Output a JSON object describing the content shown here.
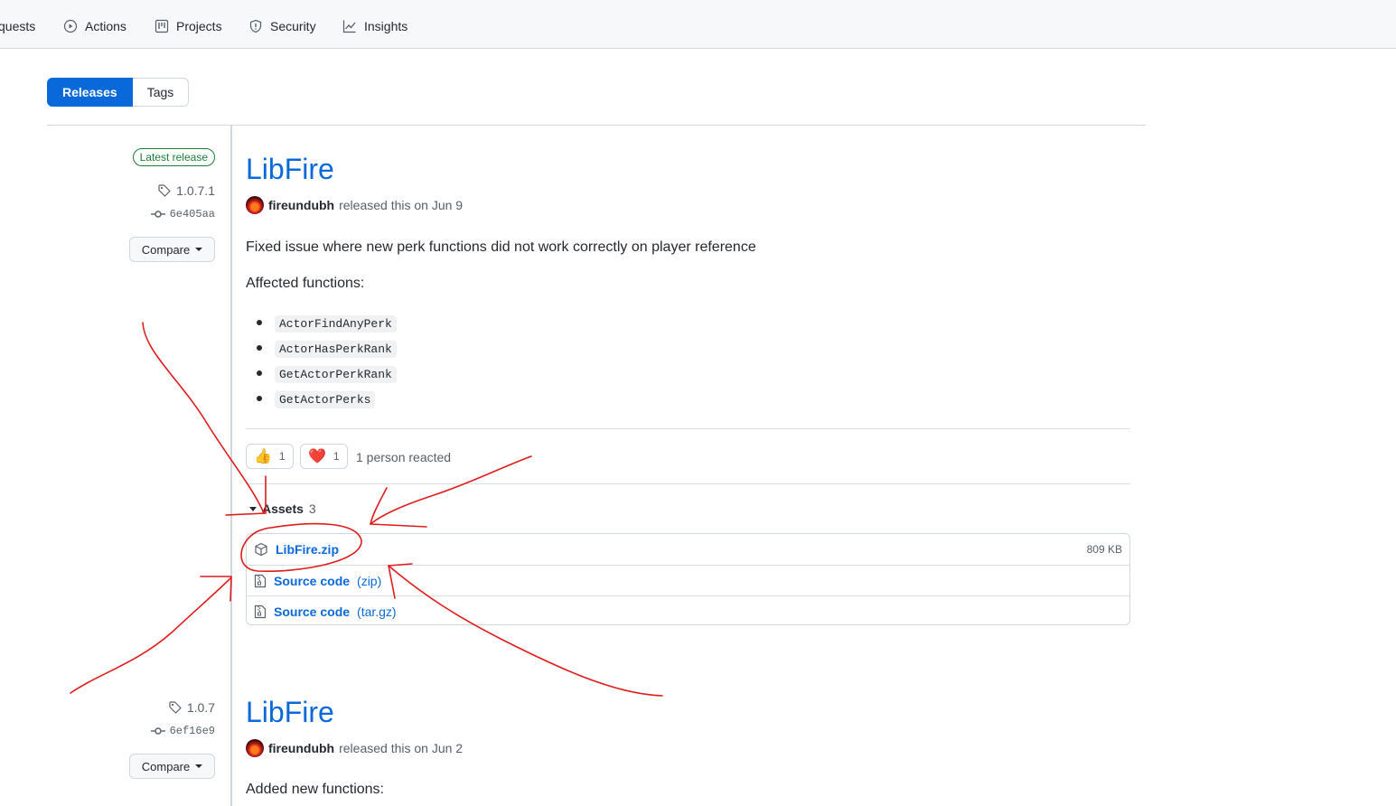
{
  "topnav": {
    "items": [
      {
        "label": "quests",
        "icon": "pull-request-icon"
      },
      {
        "label": "Actions",
        "icon": "play-circle-icon"
      },
      {
        "label": "Projects",
        "icon": "project-board-icon"
      },
      {
        "label": "Security",
        "icon": "shield-icon"
      },
      {
        "label": "Insights",
        "icon": "graph-icon"
      }
    ]
  },
  "subnav": {
    "releases": "Releases",
    "tags": "Tags"
  },
  "releases": [
    {
      "latest_badge": "Latest release",
      "tag": "1.0.7.1",
      "commit": "6e405aa",
      "compare": "Compare",
      "title": "LibFire",
      "author": "fireundubh",
      "released_text": "released this on Jun 9",
      "description": "Fixed issue where new perk functions did not work correctly on player reference",
      "affected_label": "Affected functions:",
      "functions": [
        "ActorFindAnyPerk",
        "ActorHasPerkRank",
        "GetActorPerkRank",
        "GetActorPerks"
      ],
      "reactions": [
        {
          "emoji": "👍",
          "icon": "thumbs-up-icon",
          "count": "1"
        },
        {
          "emoji": "❤️",
          "icon": "heart-icon",
          "count": "1"
        }
      ],
      "reacted_text": "1 person reacted",
      "assets_label": "Assets",
      "assets_count": "3",
      "assets": [
        {
          "name": "LibFire.zip",
          "ext": "",
          "size": "809 KB",
          "icon": "package-icon"
        },
        {
          "name": "Source code",
          "ext": "(zip)",
          "size": "",
          "icon": "file-zip-icon"
        },
        {
          "name": "Source code",
          "ext": "(tar.gz)",
          "size": "",
          "icon": "file-zip-icon"
        }
      ]
    },
    {
      "tag": "1.0.7",
      "commit": "6ef16e9",
      "compare": "Compare",
      "title": "LibFire",
      "author": "fireundubh",
      "released_text": "released this on Jun 2",
      "description": "Added new functions:"
    }
  ],
  "colors": {
    "accent": "#0969da",
    "latest_green": "#1a7f37",
    "annotation_red": "#e01b1b"
  }
}
